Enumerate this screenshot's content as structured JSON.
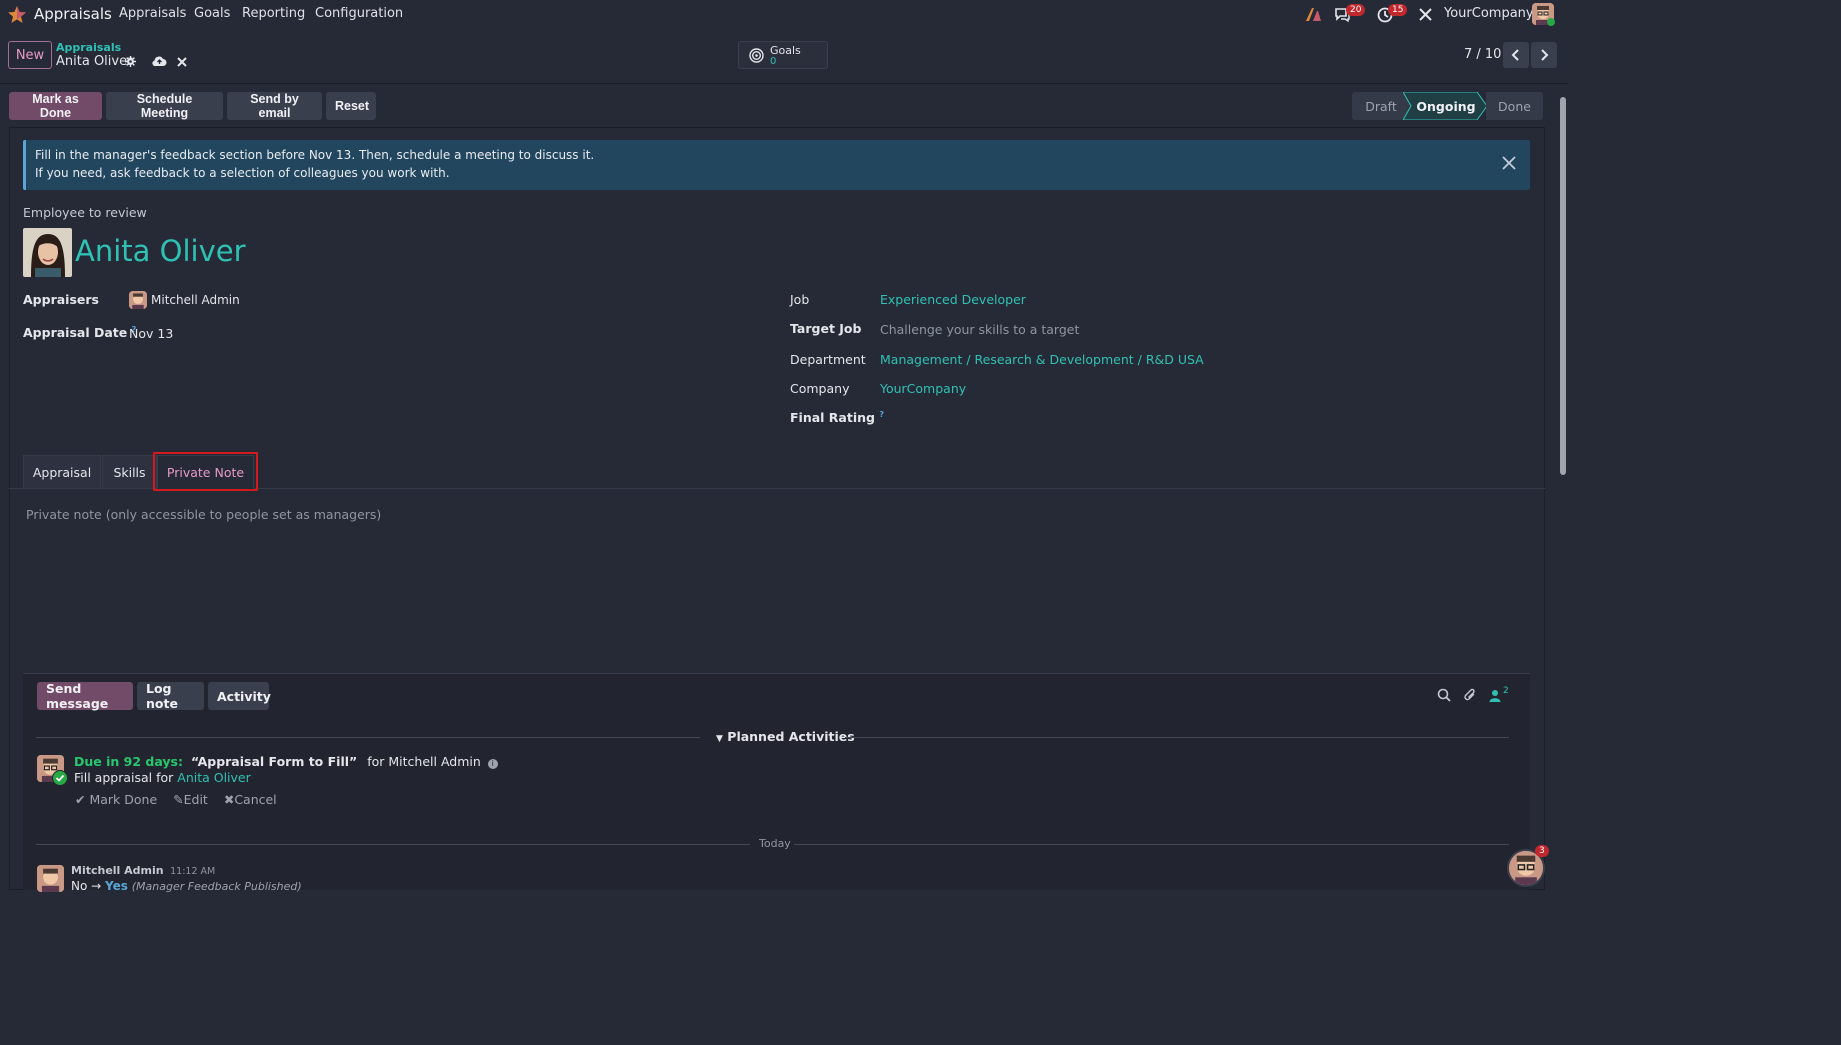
{
  "navbar": {
    "app_name": "Appraisals",
    "menu": [
      "Appraisals",
      "Goals",
      "Reporting",
      "Configuration"
    ],
    "messages_count": "20",
    "activities_count": "15",
    "company": "YourCompany"
  },
  "control_panel": {
    "new_label": "New",
    "breadcrumb_parent": "Appraisals",
    "breadcrumb_current": "Anita Oliver",
    "goals_label": "Goals",
    "goals_count": "0",
    "pager": "7 / 10"
  },
  "statusbar": {
    "buttons": [
      "Mark as Done",
      "Schedule Meeting",
      "Send by email",
      "Reset"
    ],
    "stages": [
      "Draft",
      "Ongoing",
      "Done"
    ],
    "active_stage": "Ongoing"
  },
  "alert": {
    "line1": "Fill in the manager's feedback section before Nov 13. Then, schedule a meeting to discuss it.",
    "line2": "If you need, ask feedback to a selection of colleagues you work with."
  },
  "form": {
    "employee_label": "Employee to review",
    "employee_name": "Anita Oliver",
    "appraisers_label": "Appraisers",
    "appraiser_name": "Mitchell Admin",
    "date_label": "Appraisal Date",
    "date_value": "Nov 13",
    "job_label": "Job",
    "job_value": "Experienced Developer",
    "target_job_label": "Target Job",
    "target_job_placeholder": "Challenge your skills to a target",
    "department_label": "Department",
    "department_value": "Management / Research & Development / R&D USA",
    "company_label": "Company",
    "company_value": "YourCompany",
    "final_rating_label": "Final Rating"
  },
  "tabs": [
    "Appraisal",
    "Skills",
    "Private Note"
  ],
  "active_tab": "Private Note",
  "private_note_placeholder": "Private note (only accessible to people set as managers)",
  "chatter": {
    "buttons": [
      "Send message",
      "Log note",
      "Activity"
    ],
    "followers_count": "2",
    "planned_header": "Planned Activities",
    "activity": {
      "due": "Due in 92 days:",
      "title": "“Appraisal Form to Fill”",
      "for_text": "for Mitchell Admin",
      "desc_prefix": "Fill appraisal for",
      "desc_link": "Anita Oliver",
      "actions": [
        "Mark Done",
        "Edit",
        "Cancel"
      ]
    },
    "today_label": "Today",
    "message": {
      "author": "Mitchell Admin",
      "time": "11:12 AM",
      "from": "No",
      "to": "Yes",
      "field": "(Manager Feedback Published)"
    },
    "fab_count": "3"
  },
  "colors": {
    "accent_teal": "#2fc1b4",
    "primary_purple": "#714b67",
    "highlight_red": "#d4191f"
  }
}
